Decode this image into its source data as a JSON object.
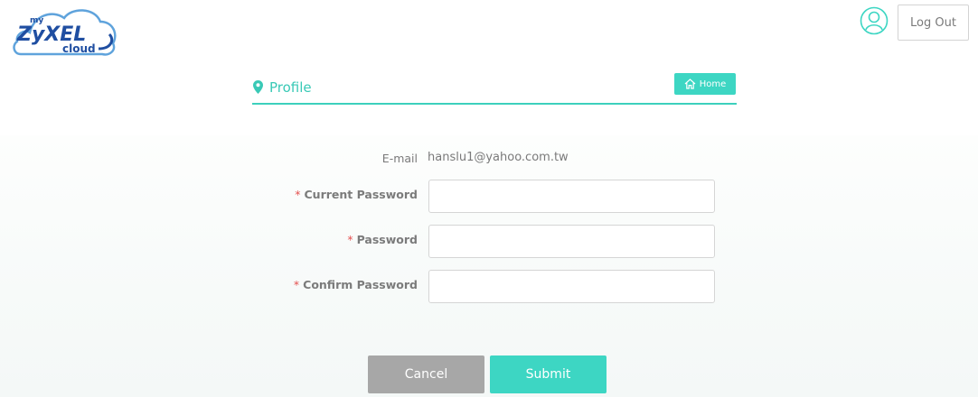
{
  "header": {
    "logo": {
      "top_text": "my",
      "main_text": "ZyXEL",
      "sub_text": "cloud"
    },
    "user_icon": "user-icon",
    "logout_label": "Log Out"
  },
  "page": {
    "title": "Profile",
    "title_icon": "map-pin-icon",
    "home_label": "Home",
    "home_icon": "home-icon"
  },
  "form": {
    "email_label": "E-mail",
    "email_value": "hanslu1@yahoo.com.tw",
    "required_mark": "*",
    "current_password_label": "Current Password",
    "current_password_value": "",
    "password_label": "Password",
    "password_value": "",
    "confirm_password_label": "Confirm Password",
    "confirm_password_value": ""
  },
  "actions": {
    "cancel_label": "Cancel",
    "submit_label": "Submit"
  },
  "colors": {
    "accent": "#3dd6c3",
    "required": "#e4504f",
    "cancel": "#a7a7a7",
    "logo_blue": "#1f4ea1"
  }
}
